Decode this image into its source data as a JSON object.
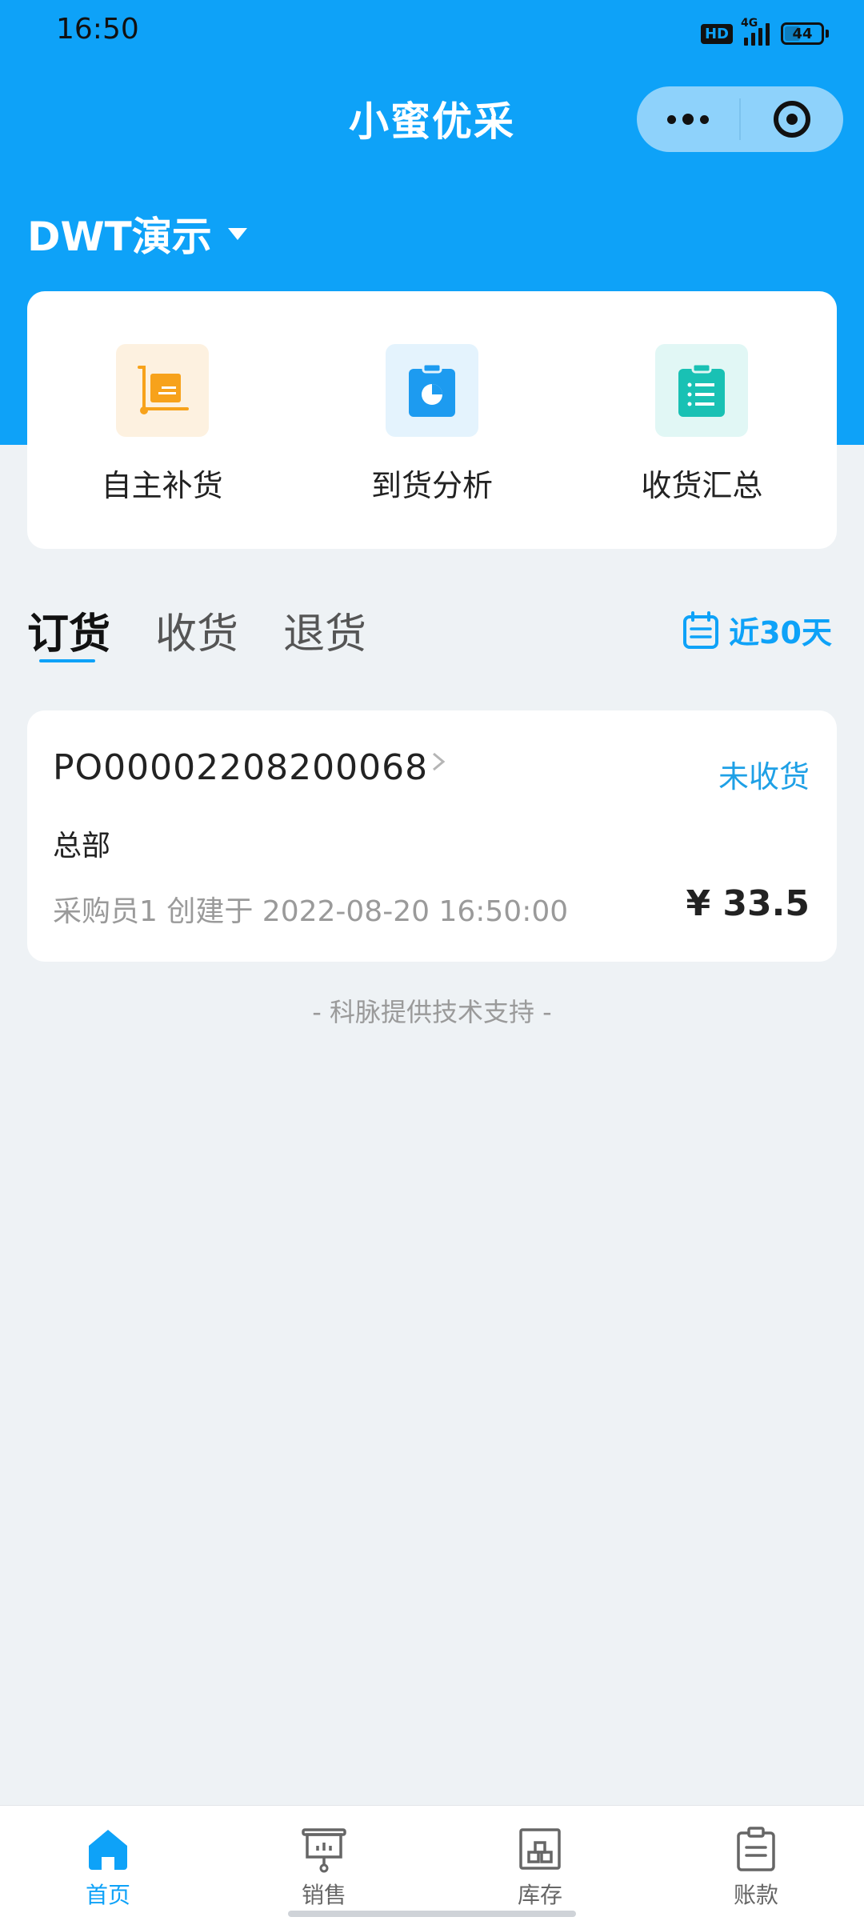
{
  "status_bar": {
    "time": "16:50",
    "hd": "HD",
    "network": "4G",
    "battery": "44"
  },
  "header": {
    "title": "小蜜优采"
  },
  "store": {
    "name": "DWT演示"
  },
  "quick_actions": [
    {
      "label": "自主补货",
      "icon": "cart-icon",
      "icon_color": "#f7a21b",
      "bg_color": "#fdf1e0"
    },
    {
      "label": "到货分析",
      "icon": "pie-chart-icon",
      "icon_color": "#1d9bf0",
      "bg_color": "#e4f3fd"
    },
    {
      "label": "收货汇总",
      "icon": "clipboard-list-icon",
      "icon_color": "#19c1b4",
      "bg_color": "#e1f7f5"
    }
  ],
  "tabs": [
    {
      "label": "订货",
      "active": true
    },
    {
      "label": "收货",
      "active": false
    },
    {
      "label": "退货",
      "active": false
    }
  ],
  "date_filter": {
    "label": "近30天",
    "icon": "calendar-icon"
  },
  "orders": [
    {
      "order_no": "PO00002208200068",
      "status": "未收货",
      "org": "总部",
      "meta": "采购员1 创建于 2022-08-20 16:50:00",
      "amount": "¥ 33.5"
    }
  ],
  "footer_note": "- 科脉提供技术支持 -",
  "tabbar": [
    {
      "label": "首页",
      "icon": "home-icon",
      "active": true
    },
    {
      "label": "销售",
      "icon": "presentation-board-icon",
      "active": false
    },
    {
      "label": "库存",
      "icon": "warehouse-icon",
      "active": false
    },
    {
      "label": "账款",
      "icon": "clipboard-icon",
      "active": false
    }
  ],
  "colors": {
    "primary": "#0ea2f8",
    "background": "#eef2f5",
    "status_text": "#1ea0e6"
  }
}
